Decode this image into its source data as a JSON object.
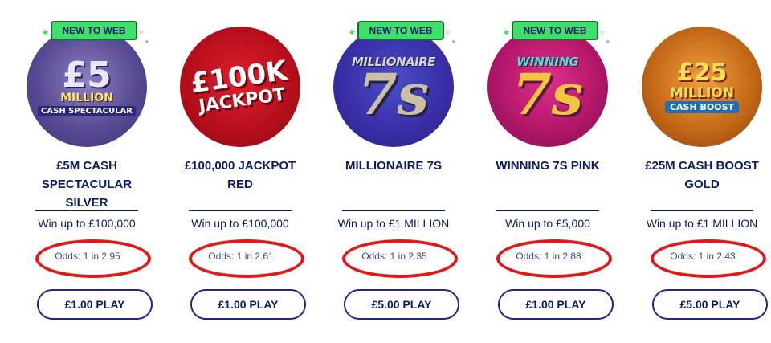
{
  "games": [
    {
      "badge": "NEW TO WEB",
      "art": {
        "line1": "£5",
        "line2": "MILLION",
        "line3": "CASH SPECTACULAR"
      },
      "name": "£5M CASH SPECTACULAR SILVER",
      "win": "Win up to £100,000",
      "odds": "Odds: 1 in 2.95",
      "play": "£1.00 PLAY"
    },
    {
      "art": {
        "line1": "£100K",
        "line2": "JACKPOT"
      },
      "name": "£100,000 JACKPOT RED",
      "win": "Win up to £100,000",
      "odds": "Odds: 1 in 2.61",
      "play": "£1.00 PLAY"
    },
    {
      "badge": "NEW TO WEB",
      "art": {
        "line1": "MILLIONAIRE",
        "line2": "7s"
      },
      "name": "MILLIONAIRE 7S",
      "win": "Win up to £1 MILLION",
      "odds": "Odds: 1 in 2.35",
      "play": "£5.00 PLAY"
    },
    {
      "badge": "NEW TO WEB",
      "art": {
        "line1": "WINNING",
        "line2": "7s"
      },
      "name": "WINNING 7S PINK",
      "win": "Win up to £5,000",
      "odds": "Odds: 1 in 2.88",
      "play": "£1.00 PLAY"
    },
    {
      "art": {
        "line1": "£25",
        "line2": "MILLION",
        "line3": "CASH BOOST"
      },
      "name": "£25M CASH BOOST GOLD",
      "win": "Win up to £1 MILLION",
      "odds": "Odds: 1 in 2.43",
      "play": "£5.00 PLAY"
    }
  ],
  "colors": {
    "brand_navy": "#0a1a6b",
    "badge_green": "#3ee06a",
    "highlight_red": "#e01818"
  },
  "icons": [
    "sparkle-icon"
  ]
}
